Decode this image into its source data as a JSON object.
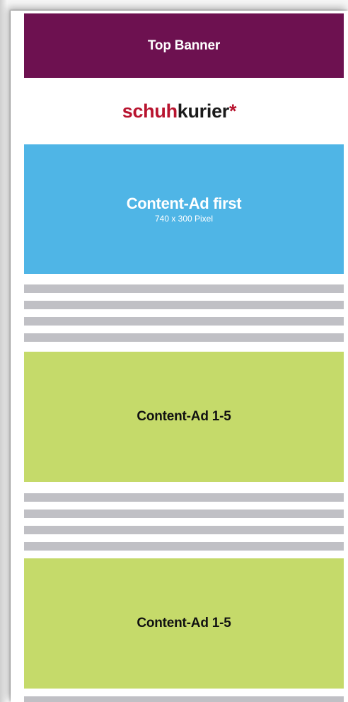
{
  "top_banner": {
    "label": "Top Banner",
    "color": "#6d1150"
  },
  "logo": {
    "part1": "schuh",
    "part2": "kurier",
    "part3": "*",
    "accent_color": "#b8142f"
  },
  "content_ad_first": {
    "title": "Content-Ad first",
    "subtitle": "740 x 300 Pixel",
    "color": "#4fb5e6"
  },
  "content_ads": [
    {
      "title": "Content-Ad 1-5"
    },
    {
      "title": "Content-Ad 1-5"
    }
  ],
  "ad_color": "#c5da6a",
  "text_line_color": "#c0c0c5"
}
